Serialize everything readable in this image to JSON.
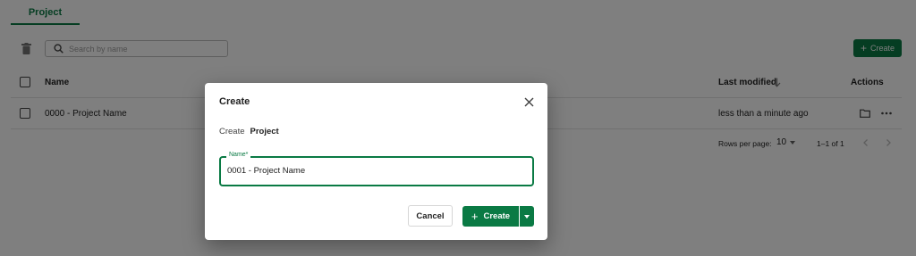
{
  "tabs": [
    {
      "label": "Project",
      "active": true
    }
  ],
  "search": {
    "placeholder": "Search by name"
  },
  "toolbar": {
    "create_label": "Create"
  },
  "table": {
    "columns": {
      "name": "Name",
      "last_modified": "Last modified",
      "actions": "Actions"
    },
    "rows": [
      {
        "name": "0000 - Project Name",
        "last_modified": "less than a minute ago"
      }
    ]
  },
  "pagination": {
    "rows_per_page_label": "Rows per page:",
    "rows_per_page_value": "10",
    "range": "1–1 of 1"
  },
  "dialog": {
    "title": "Create",
    "subtitle_prefix": "Create",
    "subtitle_entity": "Project",
    "field_label": "Name*",
    "field_value": "0001 - Project Name",
    "cancel_label": "Cancel",
    "create_label": "Create"
  },
  "colors": {
    "accent": "#0a7a44",
    "overlay": "rgba(0,0,0,0.5)"
  },
  "icons": [
    "trash-icon",
    "search-icon",
    "plus-icon",
    "arrow-down-icon",
    "folder-icon",
    "more-horizontal-icon",
    "chevron-left-icon",
    "chevron-right-icon",
    "close-icon",
    "caret-down-icon"
  ]
}
